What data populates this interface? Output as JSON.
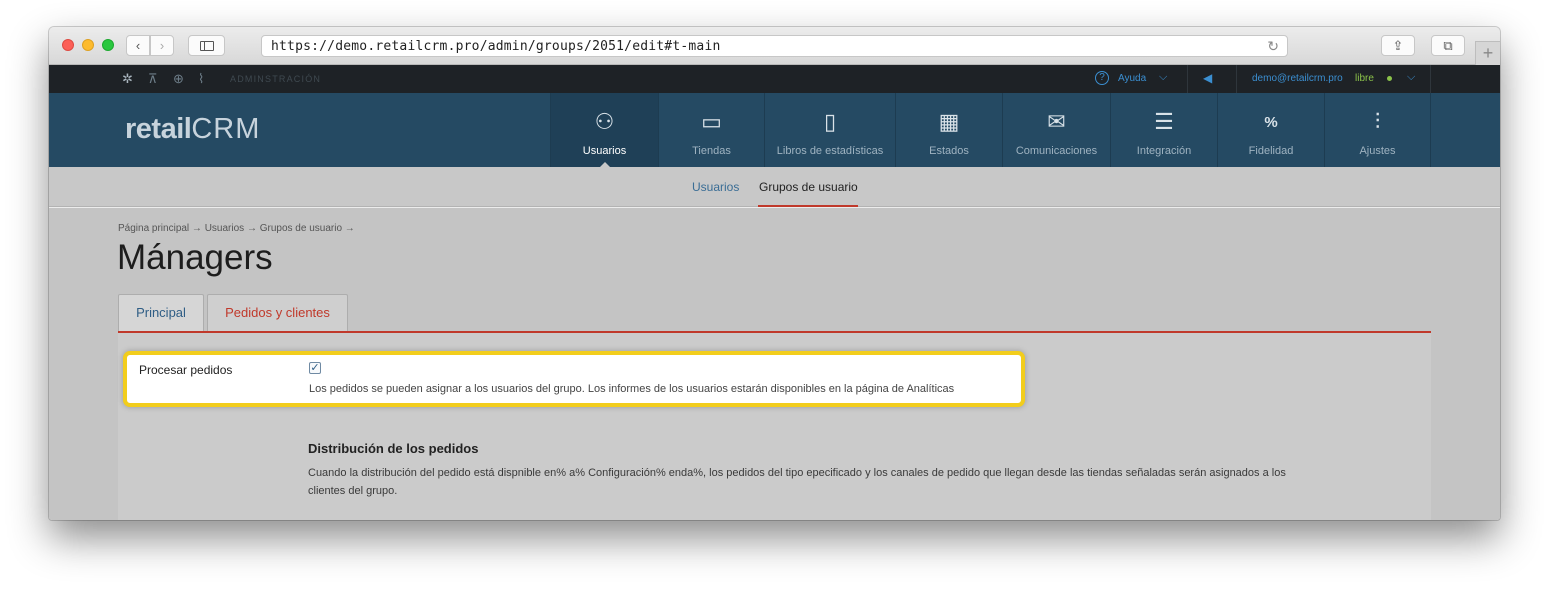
{
  "browser": {
    "url": "https://demo.retailcrm.pro/admin/groups/2051/edit#t-main",
    "nav_back": "‹",
    "nav_forward": "›",
    "reload": "↻",
    "share": "⇪",
    "tabs": "⧉",
    "new_tab": "+"
  },
  "topbar": {
    "icons": [
      "gear-icon",
      "cart-icon",
      "target-icon",
      "analytics-icon"
    ],
    "admin_label": "ADMINSTRACIÓN",
    "help_icon": "?",
    "help_label": "Ayuda",
    "chevron": "⌵",
    "user_email": "demo@retailcrm.pro",
    "user_status": "libre",
    "status_color": "#8bc34a"
  },
  "logo": {
    "retail": "retail",
    "crm": "CRM"
  },
  "nav": {
    "items": [
      {
        "label": "Usuarios",
        "icon": "user-icon",
        "glyph": "⚇",
        "active": true
      },
      {
        "label": "Tiendas",
        "icon": "store-icon",
        "glyph": "▭",
        "active": false
      },
      {
        "label": "Libros de estadísticas",
        "icon": "book-icon",
        "glyph": "▯",
        "active": false
      },
      {
        "label": "Estados",
        "icon": "status-grid-icon",
        "glyph": "▦",
        "active": false
      },
      {
        "label": "Comunicaciones",
        "icon": "mail-icon",
        "glyph": "✉",
        "active": false
      },
      {
        "label": "Integración",
        "icon": "integration-icon",
        "glyph": "☰",
        "active": false
      },
      {
        "label": "Fidelidad",
        "icon": "loyalty-icon",
        "glyph": "%",
        "active": false
      },
      {
        "label": "Ajustes",
        "icon": "settings-sliders-icon",
        "glyph": "⫶",
        "active": false
      }
    ]
  },
  "subnav": {
    "users": "Usuarios",
    "groups": "Grupos de usuario"
  },
  "breadcrumb": "Página principal → Usuarios → Grupos de usuario →",
  "page_title": "Mánagers",
  "tabs": {
    "principal": "Principal",
    "pedidos": "Pedidos y clientes"
  },
  "form": {
    "process_orders_label": "Procesar pedidos",
    "process_orders_checked": true,
    "check_mark": "✓",
    "process_orders_help": "Los pedidos se pueden asignar a los usuarios del grupo. Los informes de los usuarios estarán disponibles en la página de Analíticas",
    "distribution_title": "Distribución de los pedidos",
    "distribution_text": "Cuando la distribución del pedido está dispnible en% a% Configuración% enda%, los pedidos del tipo epecificado y los canales de pedido que llegan desde las tiendas señaladas serán asignados a los clientes del grupo."
  },
  "colors": {
    "nav_bg": "#254a63",
    "accent_red": "#c0392b",
    "link_blue": "#3b8fd1",
    "highlight_yellow": "#f2cd1c"
  }
}
